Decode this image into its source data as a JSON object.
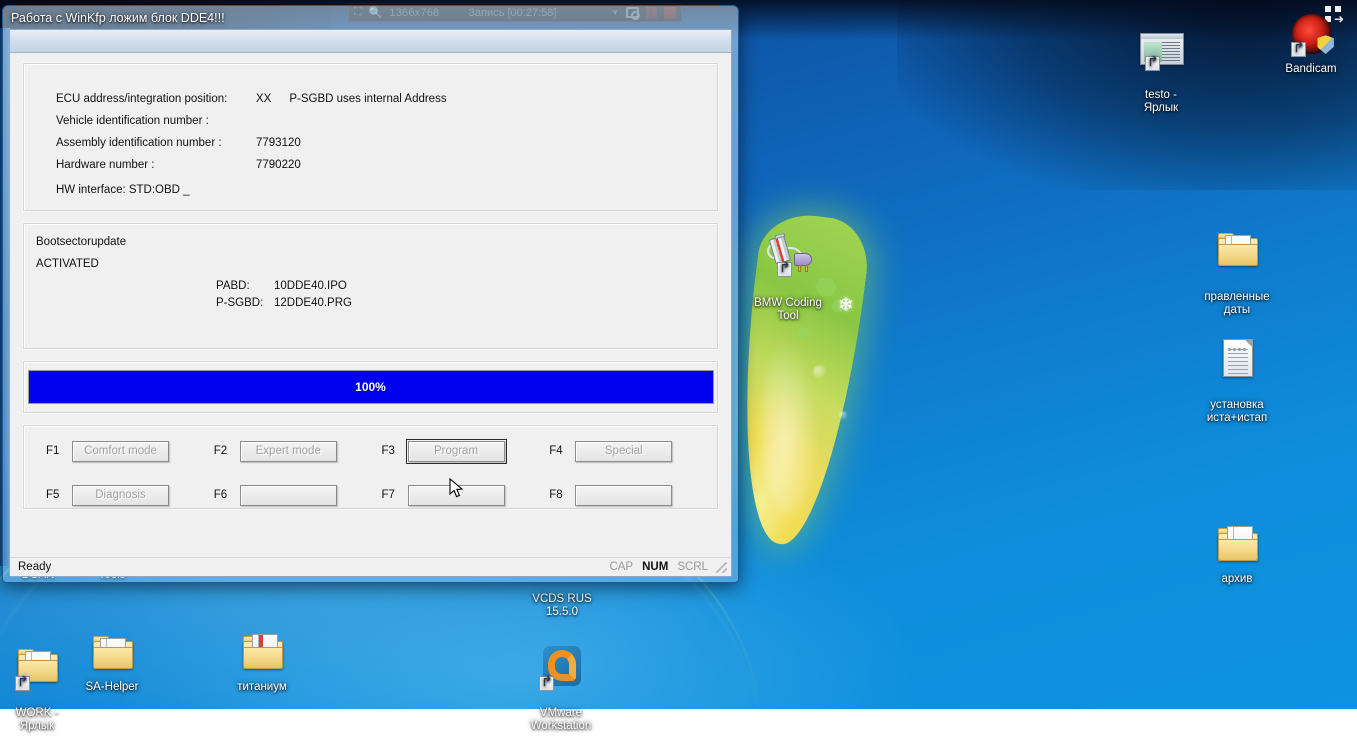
{
  "recorder_bar": {
    "expand_icon": "expand-icon",
    "magnifier_icon": "magnifier-icon",
    "resolution": "1366x768",
    "status": "Запись [00:27:58]",
    "caret_icon": "chevron-down-icon",
    "camera_icon": "camera-icon",
    "pause_icon": "pause-icon",
    "stop_icon": "stop-icon"
  },
  "window": {
    "title": "Работа с WinKfp ложим блок DDE4!!!",
    "ecu_group": {
      "rows": [
        {
          "key": "ECU address/integration position:",
          "value": "XX",
          "value2": "P-SGBD uses internal Address"
        },
        {
          "key": "Vehicle identification number :",
          "value": "",
          "value2": ""
        },
        {
          "key": "Assembly identification number :",
          "value": "7793120",
          "value2": ""
        },
        {
          "key": "Hardware number :",
          "value": "7790220",
          "value2": ""
        }
      ],
      "hw_interface": "HW interface:  STD:OBD _"
    },
    "boot_group": {
      "title": "Bootsectorupdate",
      "state": "ACTIVATED",
      "files": [
        {
          "key": "PABD:",
          "value": "10DDE40.IPO"
        },
        {
          "key": "P-SGBD:",
          "value": "12DDE40.PRG"
        }
      ]
    },
    "progress": {
      "label": "100%",
      "percent": 100,
      "color": "#0000ee"
    },
    "fkeys": [
      {
        "key": "F1",
        "label": "Comfort mode",
        "disabled": true,
        "focused": false
      },
      {
        "key": "F2",
        "label": "Expert mode",
        "disabled": true,
        "focused": false
      },
      {
        "key": "F3",
        "label": "Program",
        "disabled": true,
        "focused": true
      },
      {
        "key": "F4",
        "label": "Special",
        "disabled": true,
        "focused": false
      },
      {
        "key": "F5",
        "label": "Diagnosis",
        "disabled": true,
        "focused": false
      },
      {
        "key": "F6",
        "label": "",
        "disabled": true,
        "focused": false
      },
      {
        "key": "F7",
        "label": "",
        "disabled": true,
        "focused": false
      },
      {
        "key": "F8",
        "label": "",
        "disabled": true,
        "focused": false
      }
    ],
    "statusbar": {
      "message": "Ready",
      "cap": "CAP",
      "num": "NUM",
      "scrl": "SCRL"
    }
  },
  "desktop": {
    "icons": [
      {
        "name": "dcan",
        "label": "DCAN",
        "icon": "folder-icon"
      },
      {
        "name": "tools",
        "label": "Tools",
        "icon": "folder-icon"
      },
      {
        "name": "vcds-rus",
        "label": "VCDS RUS\n15.5.0",
        "icon": "folder-icon"
      },
      {
        "name": "work-shortcut",
        "label": "WORK -\nЯрлык",
        "icon": "folder-shortcut-icon"
      },
      {
        "name": "sa-helper",
        "label": "SA-Helper",
        "icon": "folder-icon"
      },
      {
        "name": "titanium",
        "label": "титаниум",
        "icon": "folder-open-icon"
      },
      {
        "name": "vmware",
        "label": "VMware\nWorkstation",
        "icon": "vmware-icon"
      },
      {
        "name": "bmw-coding-tool",
        "label": "BMW Coding\nTool",
        "icon": "battery-plug-icon"
      },
      {
        "name": "testo-shortcut",
        "label": "testo -\nЯрлык",
        "icon": "window-shortcut-icon"
      },
      {
        "name": "bandicam",
        "label": "Bandicam",
        "icon": "bandicam-icon"
      },
      {
        "name": "pravlennye-daty",
        "label": "правленные\nдаты",
        "icon": "folder-icon"
      },
      {
        "name": "ustanovka-ista",
        "label": "установка\nиста+истап",
        "icon": "text-document-icon"
      },
      {
        "name": "arhiv",
        "label": "архив",
        "icon": "folder-open-icon"
      }
    ],
    "colors": {
      "sky_top": "#0a3f86",
      "sky_bottom": "#0d93e0",
      "leaf_green": "#8ecb3e",
      "leaf_yellow": "#f6d94a"
    }
  }
}
